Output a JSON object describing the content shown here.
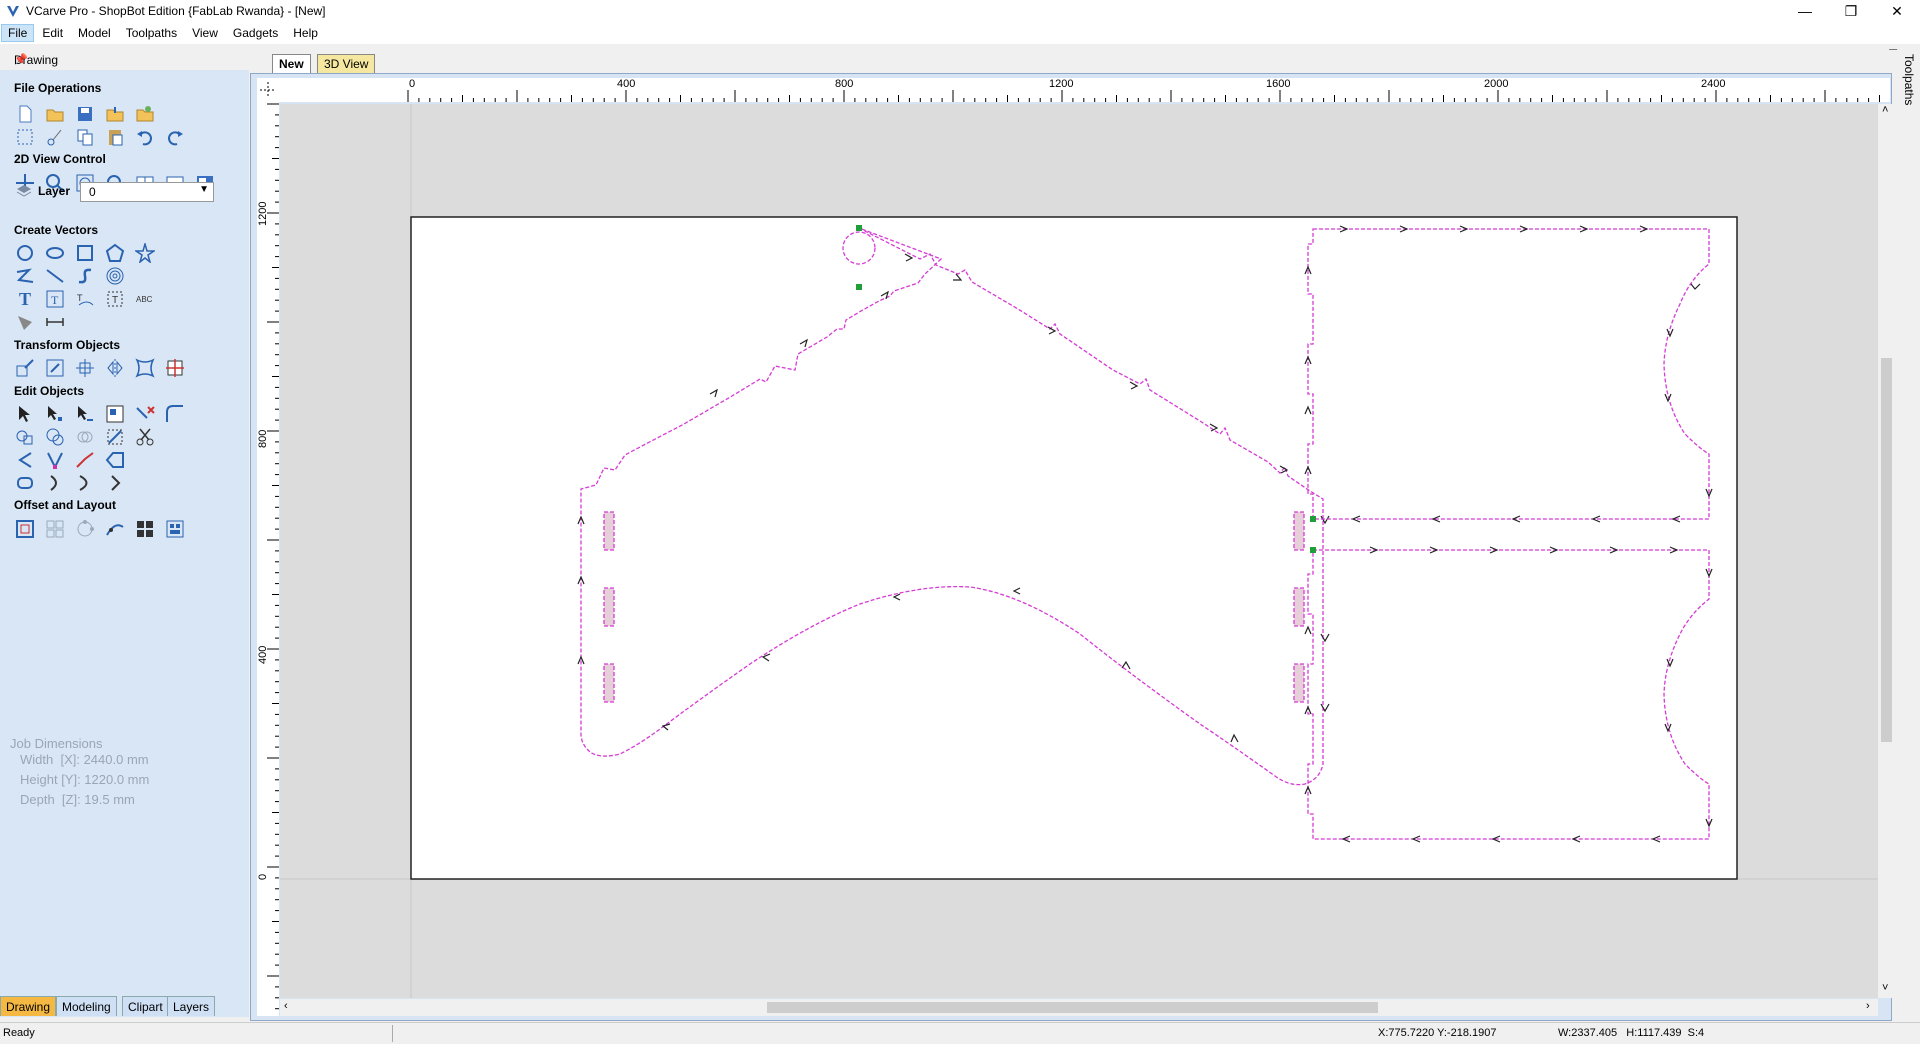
{
  "window": {
    "title": "VCarve Pro - ShopBot Edition {FabLab Rwanda} - [New]",
    "minimize": "—",
    "maximize": "❐",
    "close": "✕"
  },
  "menu": [
    "File",
    "Edit",
    "Model",
    "Toolpaths",
    "View",
    "Gadgets",
    "Help"
  ],
  "panel": {
    "header": "Drawing",
    "sections": {
      "file_ops": "File Operations",
      "view_control": "2D View Control",
      "layer": "Layer",
      "layer_value": "0",
      "create_vectors": "Create Vectors",
      "transform": "Transform Objects",
      "edit": "Edit Objects",
      "offset": "Offset and Layout"
    },
    "job": {
      "title": "Job Dimensions",
      "width": "Width  [X]: 2440.0 mm",
      "height": "Height [Y]: 1220.0 mm",
      "depth": "Depth  [Z]: 19.5 mm"
    },
    "bottom_tabs": [
      "Drawing",
      "Modeling",
      "Clipart",
      "Layers"
    ]
  },
  "doc_tabs": [
    "New",
    "3D View"
  ],
  "right_tab": "Toolpaths",
  "ruler": {
    "x_labels": [
      "0",
      "400",
      "800",
      "1200",
      "1600",
      "2000",
      "2400"
    ],
    "y_labels": [
      "1200",
      "800",
      "400",
      "0"
    ]
  },
  "status": {
    "left": "Ready",
    "coords": "X:775.7220 Y:-218.1907",
    "dims": "W:2337.405   H:1117.439  S:4"
  },
  "colors": {
    "vector": "#d63bd6",
    "panel_bg": "#d9e6f5",
    "active_tab": "#f5b943"
  }
}
